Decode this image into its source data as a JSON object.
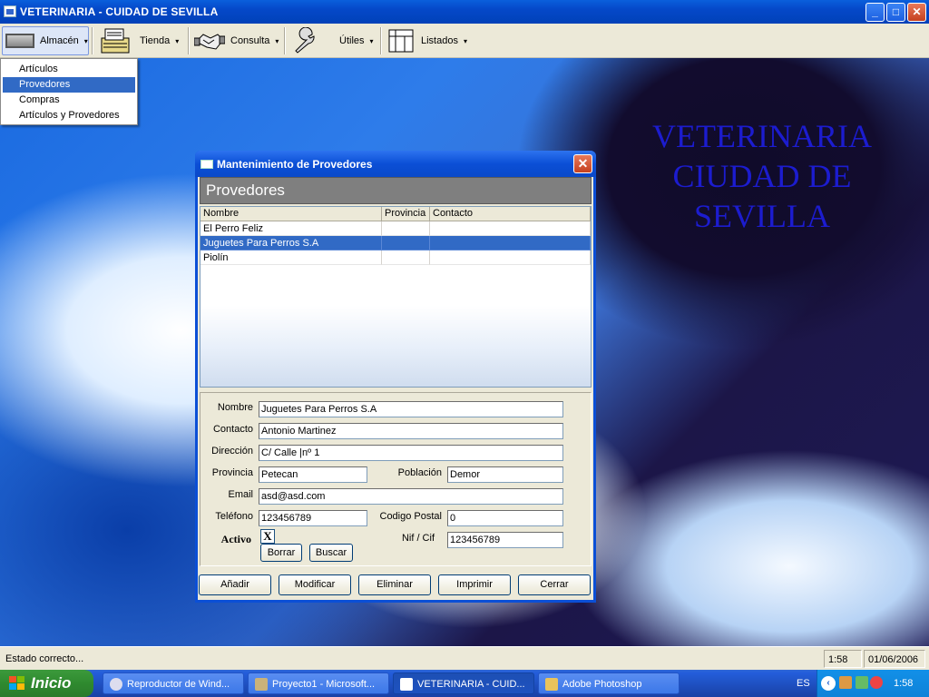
{
  "window": {
    "title": "VETERINARIA - CUIDAD DE SEVILLA",
    "btn_min": "_",
    "btn_max": "□",
    "btn_close": "✕"
  },
  "toolbar": {
    "almacen": "Almacén",
    "tienda": "Tienda",
    "consulta": "Consulta",
    "utiles": "Útiles",
    "listados": "Listados",
    "arrow": "▾"
  },
  "menu": {
    "items": [
      {
        "label": "Artículos"
      },
      {
        "label": "Provedores"
      },
      {
        "label": "Compras"
      },
      {
        "label": "Artículos y Provedores"
      }
    ],
    "selected_index": 1
  },
  "desktop": {
    "title_line1": "VETERINARIA",
    "title_line2": "CIUDAD DE",
    "title_line3": "SEVILLA",
    "title_color": "#1c1ccf"
  },
  "dialog": {
    "title": "Mantenimiento de Provedores",
    "close": "✕",
    "header": "Provedores",
    "grid": {
      "columns": [
        "Nombre",
        "Provincia",
        "Contacto"
      ],
      "rows": [
        {
          "nombre": "El Perro Feliz",
          "provincia": "",
          "contacto": ""
        },
        {
          "nombre": "Juguetes Para Perros S.A",
          "provincia": "",
          "contacto": ""
        },
        {
          "nombre": "Piolín",
          "provincia": "",
          "contacto": ""
        }
      ],
      "selected_row": 1
    },
    "form": {
      "nombre_label": "Nombre",
      "nombre": "Juguetes Para Perros S.A",
      "contacto_label": "Contacto",
      "contacto": "Antonio Martinez",
      "direccion_label": "Dirección",
      "direccion": "C/ Calle |nº 1",
      "provincia_label": "Provincia",
      "provincia": "Petecan",
      "poblacion_label": "Población",
      "poblacion": "Demor",
      "email_label": "Email",
      "email": "asd@asd.com",
      "telefono_label": "Teléfono",
      "telefono": "123456789",
      "cp_label": "Codigo Postal",
      "cp": "0",
      "activo_label": "Activo",
      "activo_mark": "X",
      "nif_label": "Nif / Cif",
      "nif": "123456789",
      "borrar": "Borrar",
      "buscar": "Buscar"
    },
    "buttons": {
      "anadir": "Añadir",
      "modificar": "Modificar",
      "eliminar": "Eliminar",
      "imprimir": "Imprimir",
      "cerrar": "Cerrar"
    }
  },
  "status": {
    "text": "Estado correcto...",
    "time": "1:58",
    "date": "01/06/2006"
  },
  "taskbar": {
    "start": "Inicio",
    "tasks": [
      "Reproductor de Wind...",
      "Proyecto1 - Microsoft...",
      "VETERINARIA - CUID...",
      "Adobe Photoshop"
    ],
    "lang": "ES",
    "clock": "1:58"
  }
}
